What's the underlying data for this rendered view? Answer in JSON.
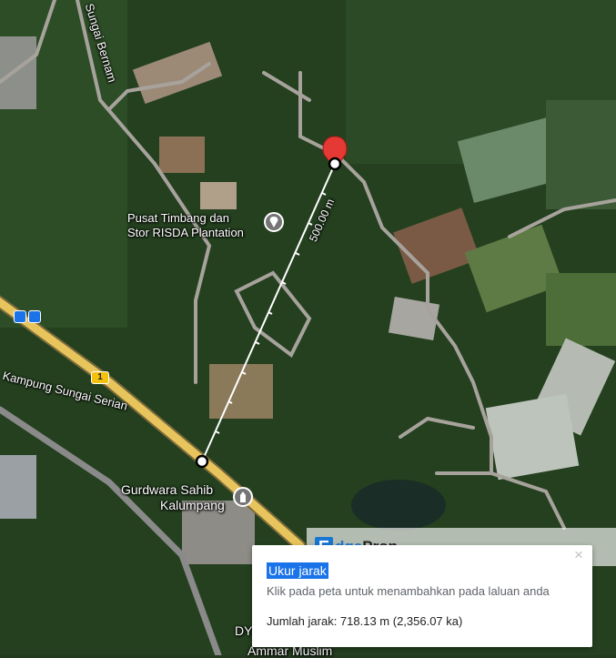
{
  "map": {
    "labels": {
      "sungai_bernam": "Sungai Bernam",
      "pusat_timbang_1": "Pusat Timbang dan",
      "pusat_timbang_2": "Stor RISDA Plantation",
      "kampung_sungai_serian": "Kampung Sungai Serian",
      "gurdwara_1": "Gurdwara Sahib",
      "gurdwara_2": "Kalumpang",
      "dy_partial": "DY",
      "ammar_muslim": "Ammar Muslim",
      "measure_label": "500.00 m",
      "route_number": "1"
    },
    "icons": {
      "destination_pin": "red-map-pin",
      "poi_plantation": "location-pin-icon",
      "poi_gurdwara": "place-of-worship-icon",
      "bus_stop": "bus-icon"
    },
    "colors": {
      "pin": "#e53935",
      "measure_line": "#ffffff",
      "highway": "#e8c45c",
      "accent": "#1a73e8"
    }
  },
  "watermark": {
    "logo_letter": "E",
    "logo_word_1": "dge",
    "logo_word_2": "Prop"
  },
  "measure_panel": {
    "title": "Ukur jarak",
    "hint": "Klik pada peta untuk menambahkan pada laluan anda",
    "total": "Jumlah jarak: 718.13 m (2,356.07 ka)",
    "close_symbol": "×"
  }
}
